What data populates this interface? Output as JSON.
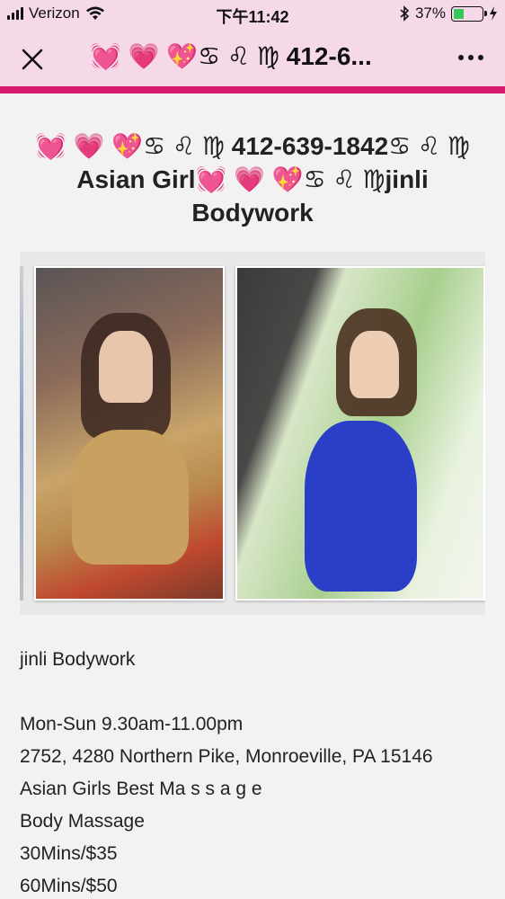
{
  "status_bar": {
    "carrier": "Verizon",
    "time": "下午11:42",
    "battery_percent": "37%",
    "battery_level": 0.37,
    "icons": [
      "signal-icon",
      "wifi-icon",
      "bluetooth-icon",
      "battery-icon",
      "charging-icon"
    ]
  },
  "nav": {
    "title": "💓 💗 💖♋ ♌ ♍ 412-6...",
    "close_icon": "close-icon",
    "more_icon": "more-icon"
  },
  "post": {
    "headline": "💓 💗 💖♋ ♌ ♍ 412-639-1842♋ ♌ ♍ Asian Girl💓 💗 💖♋ ♌ ♍jinli Bodywork",
    "photos": [
      {
        "name": "photo-1"
      },
      {
        "name": "photo-2"
      }
    ],
    "body_lines": [
      "jinli Bodywork",
      "",
      "Mon-Sun 9.30am-11.00pm",
      "2752, 4280 Northern Pike, Monroeville, PA 15146",
      "Asian Girls Best Ma s s a g e",
      "Body Massage",
      "30Mins/$35",
      "60Mins/$50"
    ]
  },
  "colors": {
    "header_bg": "#f6d9e8",
    "accent_strip": "#d81b6f",
    "page_bg": "#f2f2f2"
  }
}
